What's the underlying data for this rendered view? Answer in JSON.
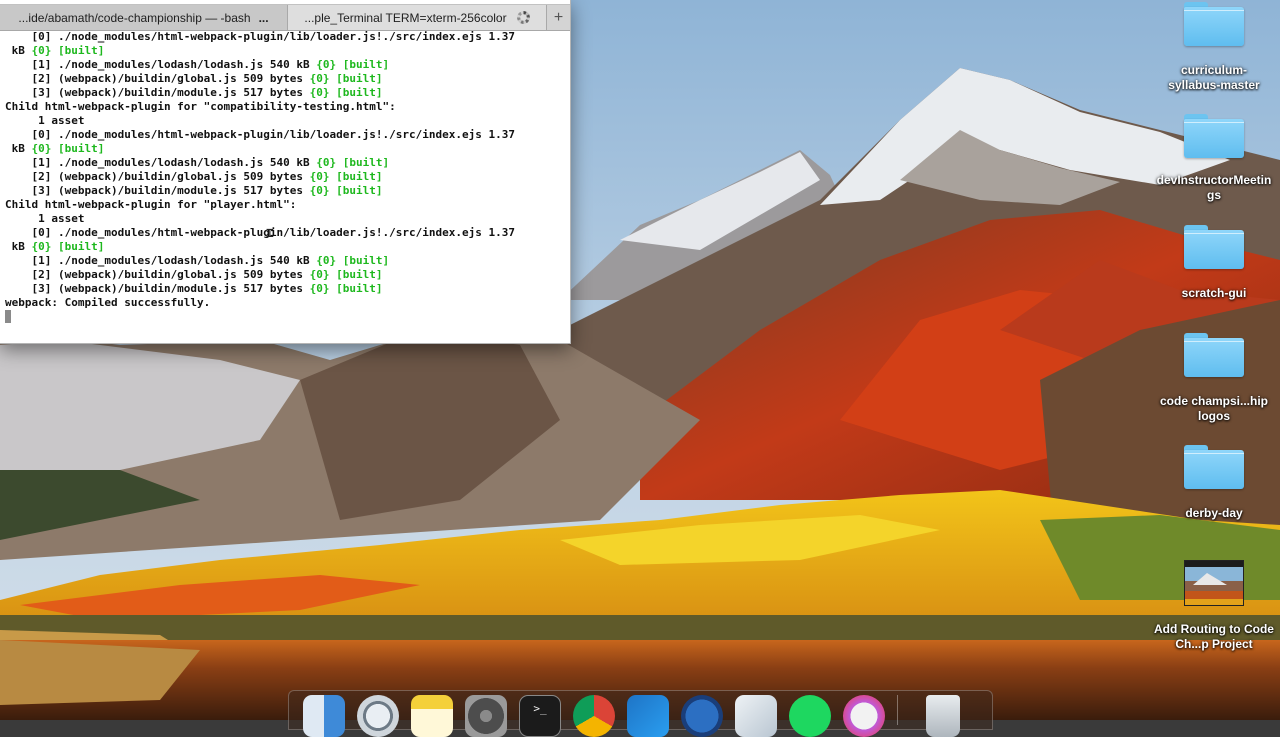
{
  "terminal": {
    "tabs": [
      {
        "label": "...ide/abamath/code-championship — -bash"
      },
      {
        "label": "...ple_Terminal TERM=xterm-256color"
      }
    ],
    "tab_overflow": "...",
    "new_tab": "+",
    "lines": [
      {
        "text": "    [0] ./node_modules/html-webpack-plugin/lib/loader.js!./src/index.ejs 1.37"
      },
      {
        "text": " kB ",
        "brace": "{0}",
        "built": "[built]"
      },
      {
        "text": "    [1] ./node_modules/lodash/lodash.js 540 kB ",
        "brace": "{0}",
        "built": "[built]"
      },
      {
        "text": "    [2] (webpack)/buildin/global.js 509 bytes ",
        "brace": "{0}",
        "built": "[built]"
      },
      {
        "text": "    [3] (webpack)/buildin/module.js 517 bytes ",
        "brace": "{0}",
        "built": "[built]"
      },
      {
        "text": "Child html-webpack-plugin for \"compatibility-testing.html\":"
      },
      {
        "text": "     1 asset"
      },
      {
        "text": "    [0] ./node_modules/html-webpack-plugin/lib/loader.js!./src/index.ejs 1.37"
      },
      {
        "text": " kB ",
        "brace": "{0}",
        "built": "[built]"
      },
      {
        "text": "    [1] ./node_modules/lodash/lodash.js 540 kB ",
        "brace": "{0}",
        "built": "[built]"
      },
      {
        "text": "    [2] (webpack)/buildin/global.js 509 bytes ",
        "brace": "{0}",
        "built": "[built]"
      },
      {
        "text": "    [3] (webpack)/buildin/module.js 517 bytes ",
        "brace": "{0}",
        "built": "[built]"
      },
      {
        "text": "Child html-webpack-plugin for \"player.html\":"
      },
      {
        "text": "     1 asset"
      },
      {
        "text": "    [0] ./node_modules/html-webpack-plugin/lib/loader.js!./src/index.ejs 1.37"
      },
      {
        "text": " kB ",
        "brace": "{0}",
        "built": "[built]"
      },
      {
        "text": "    [1] ./node_modules/lodash/lodash.js 540 kB ",
        "brace": "{0}",
        "built": "[built]"
      },
      {
        "text": "    [2] (webpack)/buildin/global.js 509 bytes ",
        "brace": "{0}",
        "built": "[built]"
      },
      {
        "text": "    [3] (webpack)/buildin/module.js 517 bytes ",
        "brace": "{0}",
        "built": "[built]"
      },
      {
        "text": "webpack: Compiled successfully."
      }
    ],
    "colors": {
      "built": "#1eb81e"
    }
  },
  "desktop": {
    "items": [
      {
        "label": "curriculum-syllabus-master",
        "kind": "folder"
      },
      {
        "label": "devInstructorMeetings",
        "kind": "folder"
      },
      {
        "label": "scratch-gui",
        "kind": "folder"
      },
      {
        "label": "code champsi...hip logos",
        "kind": "folder"
      },
      {
        "label": "derby-day",
        "kind": "folder"
      },
      {
        "label": "Add Routing to Code Ch...p Project",
        "kind": "video-thumbnail"
      }
    ]
  },
  "dock": {
    "apps": [
      {
        "name": "finder-icon"
      },
      {
        "name": "safari-icon"
      },
      {
        "name": "notes-icon"
      },
      {
        "name": "system-preferences-icon"
      },
      {
        "name": "terminal-icon"
      },
      {
        "name": "chrome-icon"
      },
      {
        "name": "vscode-icon"
      },
      {
        "name": "app-blue-icon"
      },
      {
        "name": "sourcetree-icon"
      },
      {
        "name": "spotify-icon"
      },
      {
        "name": "itunes-icon"
      },
      {
        "name": "trash-icon"
      }
    ]
  }
}
